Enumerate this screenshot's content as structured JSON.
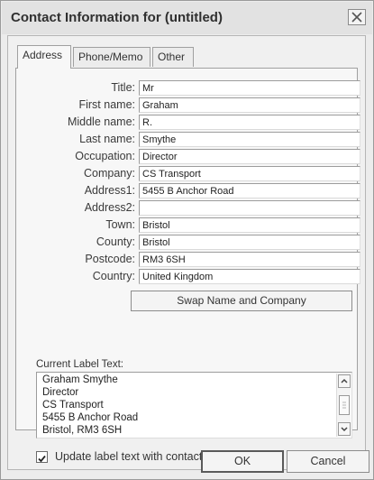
{
  "window": {
    "title": "Contact Information for (untitled)"
  },
  "tabs": [
    {
      "label": "Address",
      "active": true
    },
    {
      "label": "Phone/Memo",
      "active": false
    },
    {
      "label": "Other",
      "active": false
    }
  ],
  "fields": [
    {
      "label": "Title:",
      "value": "Mr"
    },
    {
      "label": "First name:",
      "value": "Graham"
    },
    {
      "label": "Middle name:",
      "value": "R."
    },
    {
      "label": "Last name:",
      "value": "Smythe"
    },
    {
      "label": "Occupation:",
      "value": "Director"
    },
    {
      "label": "Company:",
      "value": "CS Transport"
    },
    {
      "label": "Address1:",
      "value": "5455 B Anchor Road"
    },
    {
      "label": "Address2:",
      "value": ""
    },
    {
      "label": "Town:",
      "value": "Bristol"
    },
    {
      "label": "County:",
      "value": "Bristol"
    },
    {
      "label": "Postcode:",
      "value": "RM3 6SH"
    },
    {
      "label": "Country:",
      "value": "United Kingdom"
    }
  ],
  "swap_button": "Swap Name and Company",
  "label_text": {
    "title": "Current Label Text:",
    "lines": [
      "Graham Smythe",
      "Director",
      "CS Transport",
      "5455 B Anchor Road",
      "Bristol, RM3 6SH"
    ]
  },
  "update_checkbox": {
    "label": "Update label text with contact information",
    "checked": true
  },
  "buttons": {
    "ok": "OK",
    "cancel": "Cancel"
  }
}
